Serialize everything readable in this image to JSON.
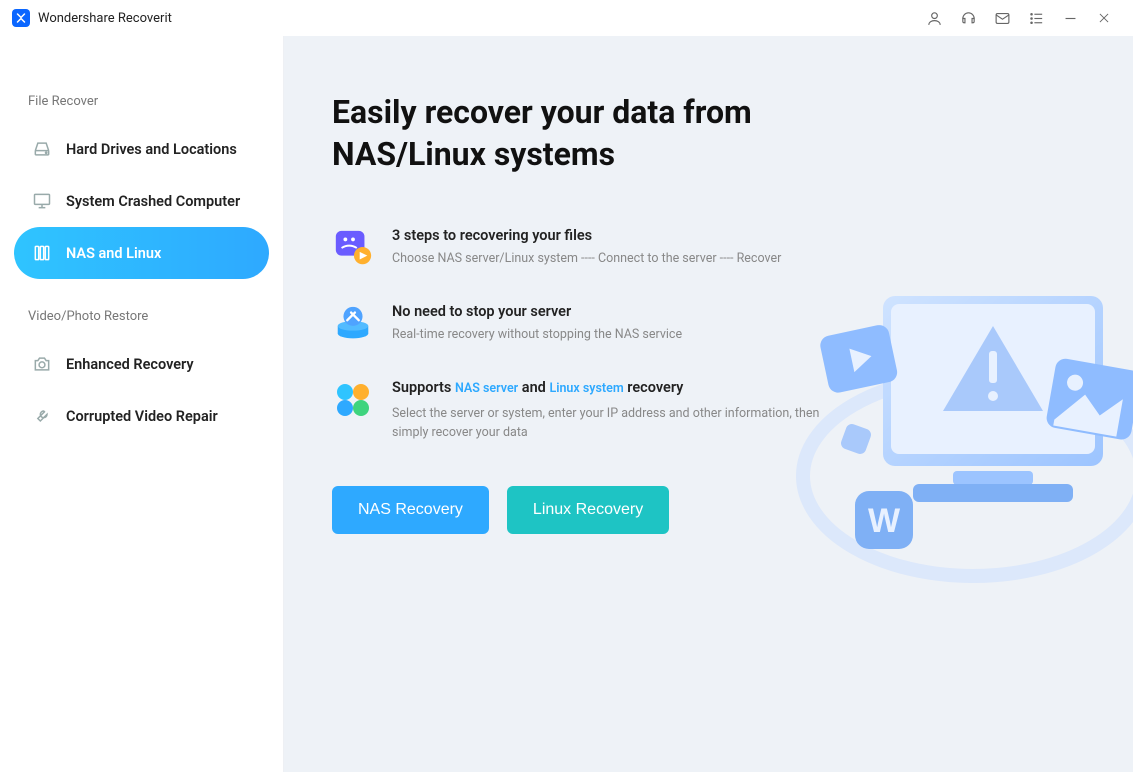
{
  "app": {
    "title": "Wondershare Recoverit"
  },
  "sidebar": {
    "section1_label": "File Recover",
    "section2_label": "Video/Photo Restore",
    "items": {
      "hard_drives": "Hard Drives and Locations",
      "system_crashed": "System Crashed Computer",
      "nas_linux": "NAS and Linux",
      "enhanced_recovery": "Enhanced Recovery",
      "corrupted_video": "Corrupted Video Repair"
    }
  },
  "main": {
    "headline": "Easily recover your data from NAS/Linux systems",
    "features": [
      {
        "title": "3 steps to recovering your files",
        "desc": "Choose NAS server/Linux system ---- Connect to the server ---- Recover"
      },
      {
        "title": "No need to stop your server",
        "desc": "Real-time recovery without stopping the NAS service"
      },
      {
        "title_prefix": "Supports ",
        "title_link1": "NAS server",
        "title_mid": " and ",
        "title_link2": "Linux system",
        "title_suffix": " recovery",
        "desc": "Select the server or system, enter your IP address and other information, then simply recover your data"
      }
    ],
    "buttons": {
      "nas": "NAS Recovery",
      "linux": "Linux Recovery"
    }
  }
}
